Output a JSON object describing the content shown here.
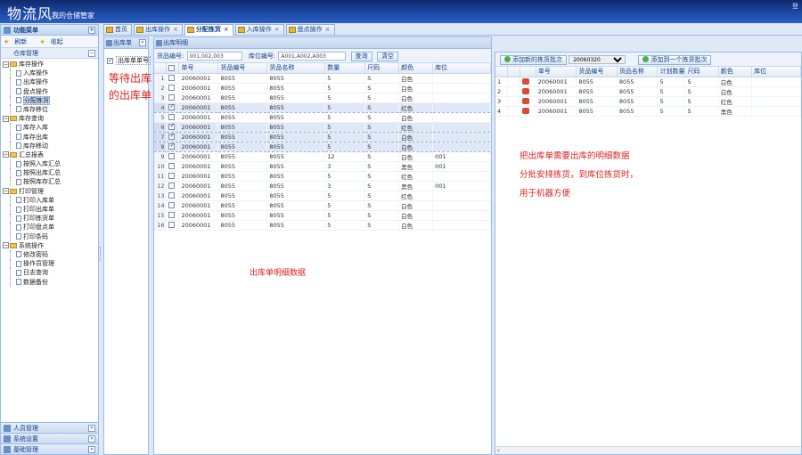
{
  "header": {
    "logo": "物流风",
    "slogan": "我的仓储管家",
    "user_link": "登"
  },
  "nav": {
    "title": "功能菜单",
    "tools": [
      "刷新",
      "收起"
    ],
    "section_title": "仓库管理",
    "tree": [
      {
        "label": "库存操作",
        "items": [
          {
            "label": "入库操作"
          },
          {
            "label": "出库操作"
          },
          {
            "label": "盘点操作"
          },
          {
            "label": "分配拣货",
            "selected": true
          },
          {
            "label": "库存移位"
          }
        ]
      },
      {
        "label": "库存查询",
        "items": [
          {
            "label": "库存入库"
          },
          {
            "label": "库存出库"
          },
          {
            "label": "库存移动"
          }
        ]
      },
      {
        "label": "汇总报表",
        "items": [
          {
            "label": "按照入库汇总"
          },
          {
            "label": "按照出库汇总"
          },
          {
            "label": "按照库存汇总"
          }
        ]
      },
      {
        "label": "打印管理",
        "items": [
          {
            "label": "打印入库单"
          },
          {
            "label": "打印出库单"
          },
          {
            "label": "打印拣货单"
          },
          {
            "label": "打印盘点单"
          },
          {
            "label": "打印条码"
          }
        ]
      },
      {
        "label": "系统操作",
        "items": [
          {
            "label": "修改密码"
          },
          {
            "label": "操作员管理"
          },
          {
            "label": "日志查询"
          },
          {
            "label": "数据备份"
          }
        ]
      }
    ],
    "bottom": [
      "人员管理",
      "系统设置",
      "基础管理"
    ]
  },
  "tabs": [
    {
      "label": "首页"
    },
    {
      "label": "出库操作"
    },
    {
      "label": "分配拣货",
      "active": true
    },
    {
      "label": "入库操作"
    },
    {
      "label": "盘点操作"
    }
  ],
  "leftpane": {
    "title": "出库单",
    "row_label": "出库单单号"
  },
  "centerpane": {
    "title": "出库明细",
    "filter1_label": "货品编号:",
    "filter1_value": "001,002,003",
    "filter2_label": "库位编号:",
    "filter2_value": "A001,A002,A003",
    "btn_query": "查询",
    "btn_clear": "清空",
    "columns": [
      "单号",
      "货品编号",
      "货品名称",
      "数量",
      "尺码",
      "颜色",
      "库位"
    ],
    "rows": [
      {
        "n": "1",
        "checked": false,
        "selected": false,
        "id": "20060001",
        "code": "8055",
        "name": "8055",
        "qty": "5",
        "size": "S",
        "color": "白色",
        "loc": ""
      },
      {
        "n": "2",
        "checked": false,
        "selected": false,
        "id": "20060001",
        "code": "8055",
        "name": "8055",
        "qty": "5",
        "size": "S",
        "color": "白色",
        "loc": ""
      },
      {
        "n": "3",
        "checked": false,
        "selected": false,
        "id": "20060001",
        "code": "8055",
        "name": "8055",
        "qty": "5",
        "size": "S",
        "color": "白色",
        "loc": ""
      },
      {
        "n": "4",
        "checked": true,
        "selected": true,
        "id": "20060001",
        "code": "8055",
        "name": "8055",
        "qty": "5",
        "size": "S",
        "color": "红色",
        "loc": ""
      },
      {
        "n": "5",
        "checked": false,
        "selected": false,
        "id": "20060001",
        "code": "8055",
        "name": "8055",
        "qty": "5",
        "size": "S",
        "color": "白色",
        "loc": ""
      },
      {
        "n": "6",
        "checked": true,
        "selected": true,
        "id": "20060001",
        "code": "8055",
        "name": "8055",
        "qty": "5",
        "size": "S",
        "color": "红色",
        "loc": ""
      },
      {
        "n": "7",
        "checked": true,
        "selected": true,
        "id": "20060001",
        "code": "8055",
        "name": "8055",
        "qty": "5",
        "size": "S",
        "color": "白色",
        "loc": ""
      },
      {
        "n": "8",
        "checked": true,
        "selected": true,
        "id": "20060001",
        "code": "8055",
        "name": "8055",
        "qty": "5",
        "size": "S",
        "color": "白色",
        "loc": ""
      },
      {
        "n": "9",
        "checked": false,
        "selected": false,
        "id": "20060001",
        "code": "8055",
        "name": "8055",
        "qty": "12",
        "size": "S",
        "color": "白色",
        "loc": "001"
      },
      {
        "n": "10",
        "checked": false,
        "selected": false,
        "id": "20060001",
        "code": "8055",
        "name": "8055",
        "qty": "3",
        "size": "S",
        "color": "黑色",
        "loc": "001"
      },
      {
        "n": "11",
        "checked": false,
        "selected": false,
        "id": "20060001",
        "code": "8055",
        "name": "8055",
        "qty": "5",
        "size": "S",
        "color": "红色",
        "loc": ""
      },
      {
        "n": "12",
        "checked": false,
        "selected": false,
        "id": "20060001",
        "code": "8055",
        "name": "8055",
        "qty": "3",
        "size": "S",
        "color": "黑色",
        "loc": "001"
      },
      {
        "n": "13",
        "checked": false,
        "selected": false,
        "id": "20060001",
        "code": "8055",
        "name": "8055",
        "qty": "5",
        "size": "S",
        "color": "红色",
        "loc": ""
      },
      {
        "n": "14",
        "checked": false,
        "selected": false,
        "id": "20060001",
        "code": "8055",
        "name": "8055",
        "qty": "5",
        "size": "S",
        "color": "白色",
        "loc": ""
      },
      {
        "n": "15",
        "checked": false,
        "selected": false,
        "id": "20060001",
        "code": "8055",
        "name": "8055",
        "qty": "5",
        "size": "S",
        "color": "白色",
        "loc": ""
      },
      {
        "n": "16",
        "checked": false,
        "selected": false,
        "id": "20060001",
        "code": "8055",
        "name": "8055",
        "qty": "5",
        "size": "S",
        "color": "白色",
        "loc": ""
      }
    ]
  },
  "rightpane": {
    "btn_batch_label": "添加新的拣货批次",
    "batch_value": "20060320",
    "batch_options": [
      "20060320"
    ],
    "btn_add_to_batch": "添加到一个拣货批次",
    "columns": [
      "单号",
      "货品编号",
      "货品名称",
      "计划数量",
      "尺码",
      "颜色",
      "库位"
    ],
    "rows": [
      {
        "n": "1",
        "id": "20060001",
        "code": "8055",
        "name": "8055",
        "qty": "5",
        "size": "S",
        "color": "白色"
      },
      {
        "n": "2",
        "id": "20060001",
        "code": "8055",
        "name": "8055",
        "qty": "5",
        "size": "S",
        "color": "白色"
      },
      {
        "n": "3",
        "id": "20060001",
        "code": "8055",
        "name": "8055",
        "qty": "5",
        "size": "S",
        "color": "红色"
      },
      {
        "n": "4",
        "id": "20060001",
        "code": "8055",
        "name": "8055",
        "qty": "5",
        "size": "S",
        "color": "黑色"
      }
    ]
  },
  "annotations": {
    "left_line1": "等待出库",
    "left_line2": "的出库单",
    "center": "出库单明细数据",
    "right_line1": "把出库单需要出库的明细数据",
    "right_line2": "分批安排拣货，到库位拣货时，",
    "right_line3": "用于机器方便"
  },
  "colors": {
    "header_bg": "#1d4aa8",
    "panel_border": "#99bbe8",
    "annotation": "#e02020"
  }
}
